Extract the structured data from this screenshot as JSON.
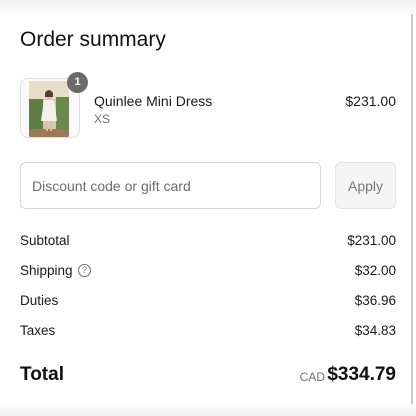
{
  "summary": {
    "title": "Order summary"
  },
  "product": {
    "name": "Quinlee Mini Dress",
    "variant": "XS",
    "price": "$231.00",
    "quantity": "1",
    "image_icon": "dress-product-photo"
  },
  "discount": {
    "placeholder": "Discount code or gift card",
    "value": "",
    "apply_label": "Apply"
  },
  "lines": {
    "subtotal_label": "Subtotal",
    "subtotal_value": "$231.00",
    "shipping_label": "Shipping",
    "shipping_help_icon": "question-circle-icon",
    "shipping_value": "$32.00",
    "duties_label": "Duties",
    "duties_value": "$36.96",
    "taxes_label": "Taxes",
    "taxes_value": "$34.83"
  },
  "total": {
    "label": "Total",
    "currency": "CAD",
    "value": "$334.79"
  }
}
